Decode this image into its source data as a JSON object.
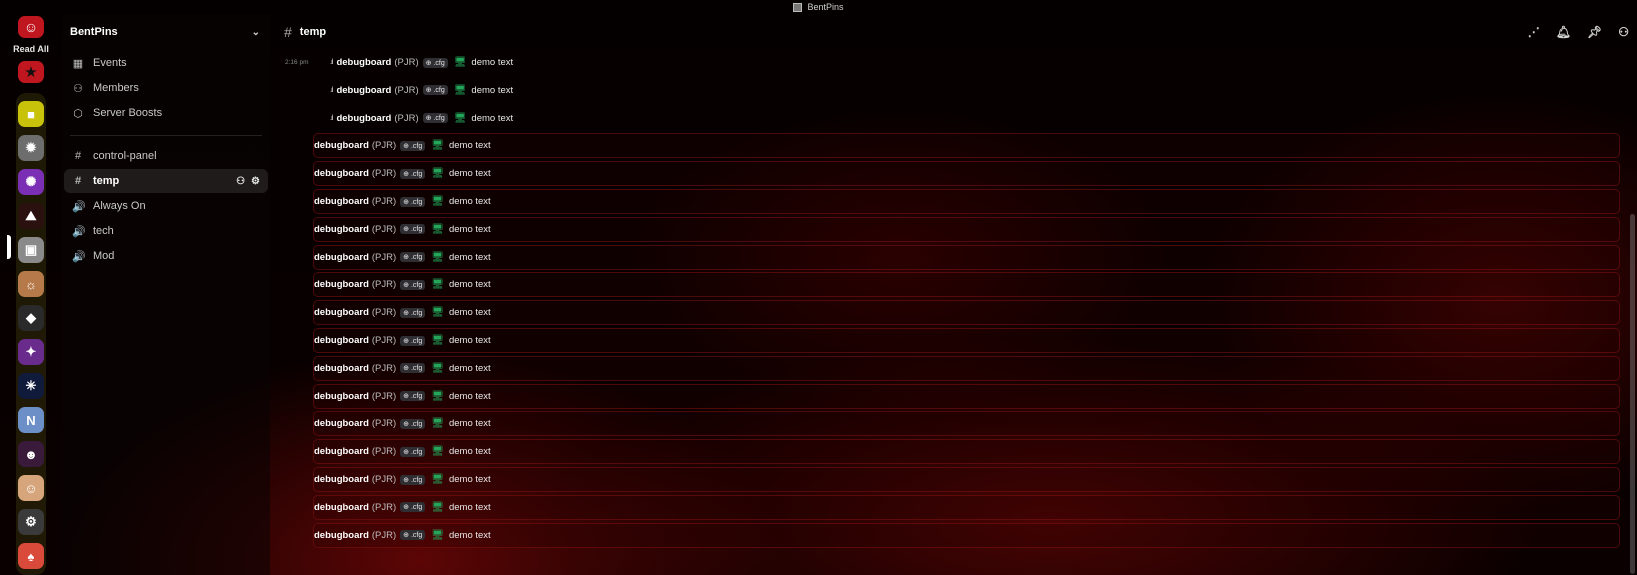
{
  "window": {
    "title": "BentPins"
  },
  "rail": {
    "read_all_label": "Read All",
    "servers": [
      {
        "name": "folder-server",
        "color": "#c8c20a",
        "glyph": "■"
      },
      {
        "name": "spiky-server",
        "color": "#6d6d6d",
        "glyph": "✹"
      },
      {
        "name": "purple-server",
        "color": "#7a2fb5",
        "glyph": "✺"
      },
      {
        "name": "red-stand-server",
        "color": "#2b1010",
        "glyph": "⛰"
      },
      {
        "name": "gray-box-server",
        "color": "#8a8a8a",
        "glyph": "▣"
      },
      {
        "name": "sunset-server",
        "color": "#b5794a",
        "glyph": "☼"
      },
      {
        "name": "diamond-server",
        "color": "#2a2a2a",
        "glyph": "◆"
      },
      {
        "name": "party-server",
        "color": "#6a2c8c",
        "glyph": "✦"
      },
      {
        "name": "blue-star-server",
        "color": "#101a3a",
        "glyph": "✳"
      },
      {
        "name": "never-server",
        "color": "#6d8fc8",
        "glyph": "N"
      },
      {
        "name": "mask-server",
        "color": "#3a1a3a",
        "glyph": "☻"
      },
      {
        "name": "face-server",
        "color": "#d6a57c",
        "glyph": "☺"
      },
      {
        "name": "gear-server",
        "color": "#3a3a3a",
        "glyph": "⚙"
      },
      {
        "name": "pterodactyl-server",
        "color": "#d94a3a",
        "glyph": "♠"
      }
    ]
  },
  "sidebar": {
    "server_name": "BentPins",
    "top_items": [
      {
        "label": "Events",
        "icon": "▦"
      },
      {
        "label": "Members",
        "icon": "⚇"
      },
      {
        "label": "Server Boosts",
        "icon": "⬡"
      }
    ],
    "channels": [
      {
        "label": "control-panel",
        "icon": "#"
      },
      {
        "label": "temp",
        "icon": "#"
      },
      {
        "label": "Always On",
        "icon": "🔊"
      },
      {
        "label": "tech",
        "icon": "🔊"
      },
      {
        "label": "Mod",
        "icon": "🔊"
      }
    ]
  },
  "header": {
    "channel_name": "temp"
  },
  "messages": {
    "time": "2:16 pm",
    "username": "debugboard",
    "tag": "(PJR)",
    "badge": "⊕ .cfg",
    "activity": "demo text"
  }
}
